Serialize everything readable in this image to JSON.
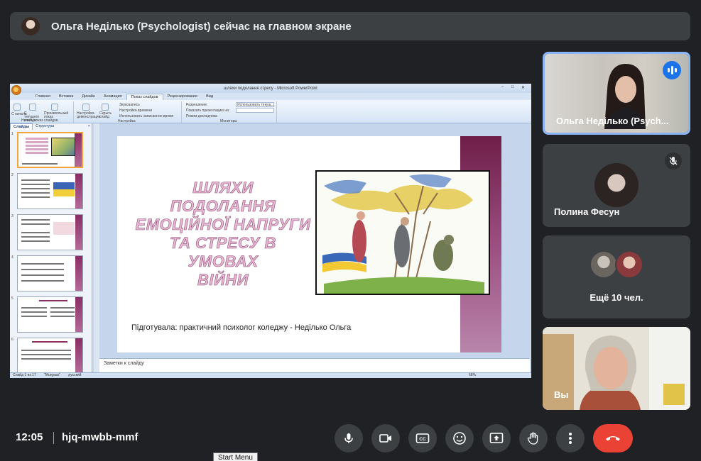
{
  "banner": {
    "text": "Ольга Неділько (Psychologist) сейчас на главном экране"
  },
  "presentation": {
    "window_title": "шляхи подолання стресу - Microsoft PowerPoint",
    "ribbon_tabs": [
      "Главная",
      "Вставка",
      "Дизайн",
      "Анимация",
      "Показ слайдов",
      "Рецензирование",
      "Вид"
    ],
    "active_tab": "Показ слайдов",
    "ribbon": {
      "btn_from_start": "С начала",
      "btn_from_current": "С текущего слайда",
      "btn_custom": "Произвольный показ",
      "btn_setup": "Настройка демонстрации",
      "btn_hide": "Скрыть слайд",
      "opt_narration": "Звукозапись",
      "opt_timing": "Настройка времени",
      "opt_use_timing": "Использовать записанное время",
      "group_setup": "Настройка",
      "group_start": "Начать показ слайдов",
      "opt_resolution": "Разрешение:",
      "opt_resolution_value": "Использовать текущ...",
      "opt_show_on": "Показать презентацию на:",
      "opt_presenter": "Режим докладчика",
      "group_monitors": "Мониторы"
    },
    "left_tabs": [
      "Слайды",
      "Структура"
    ],
    "slide": {
      "heading_lines": [
        "ШЛЯХИ",
        "ПОДОЛАННЯ",
        "ЕМОЦІЙНОЇ НАПРУГИ",
        "ТА СТРЕСУ В УМОВАХ",
        "ВІЙНИ"
      ],
      "author": "Підготувала: практичний психолог коледжу - Неділько Ольга"
    },
    "thumb_numbers": [
      "1",
      "2",
      "3",
      "4",
      "5",
      "6"
    ],
    "notes_placeholder": "Заметки к слайду",
    "status": {
      "slide": "Слайд 1 из 17",
      "theme": "\"Murgaax\"",
      "lang": "русский",
      "zoom": "66%"
    }
  },
  "participants": [
    {
      "name": "Ольга Неділько (Psych...",
      "speaking": true
    },
    {
      "name": "Полина Фесун",
      "muted": true
    },
    {
      "name": "Ещё 10 чел."
    },
    {
      "name": "Вы"
    }
  ],
  "meeting": {
    "time": "12:05",
    "code": "hjq-mwbb-mmf"
  },
  "tooltip": "Start Menu",
  "colors": {
    "background": "#202124",
    "tile": "#3c4043",
    "end_call": "#ea4335",
    "speaking": "#1a73e8"
  }
}
